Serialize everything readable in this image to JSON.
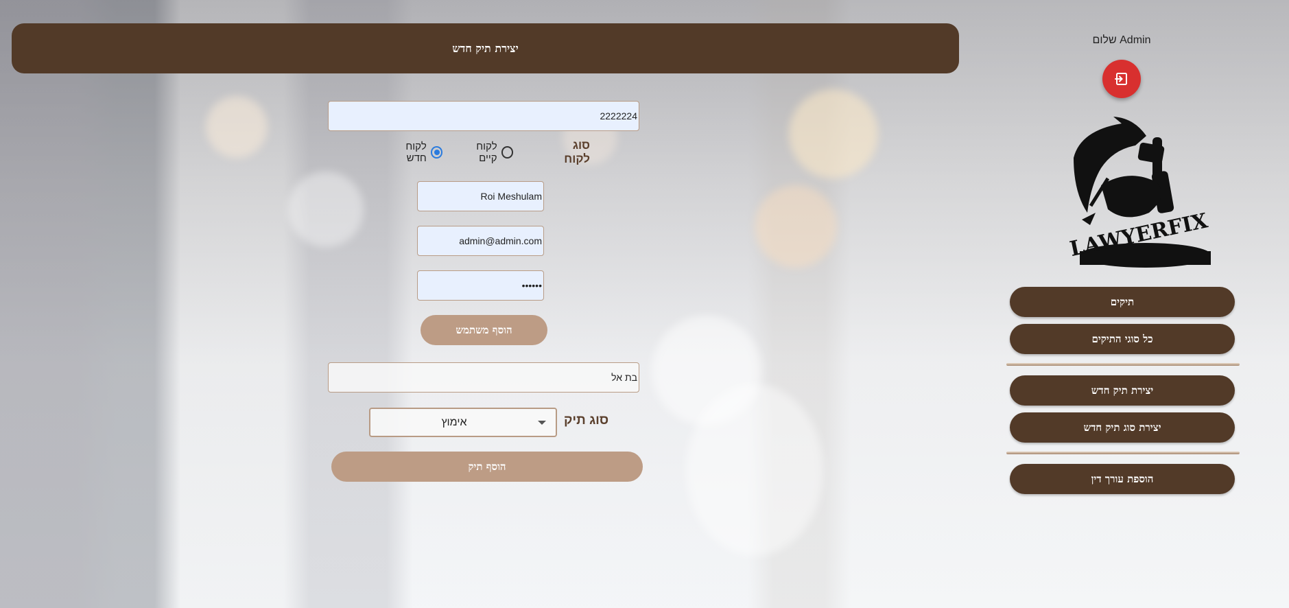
{
  "header": {
    "title": "יצירת תיק חדש"
  },
  "form": {
    "case_number": "2222224",
    "client_type_label": "סוג לקוח",
    "client_type_options": [
      "לקוח חדש",
      "לקוח קיים"
    ],
    "client_type_selected": "לקוח חדש",
    "client_name": "Roi Meshulam",
    "client_email": "admin@admin.com",
    "client_password": "••••••",
    "add_user_label": "הוסף משתמש",
    "lawyer_name": "בת אל",
    "case_type_label": "סוג תיק",
    "case_type_value": "אימוץ",
    "add_case_label": "הוסף תיק"
  },
  "sidebar": {
    "greeting": "שלום Admin",
    "logo_text": "LAWYERFIX",
    "nav": {
      "cases": "תיקים",
      "all_case_types": "כל סוגי התיקים",
      "create_case": "יצירת תיק חדש",
      "create_case_type": "יצירת סוג תיק חדש",
      "add_lawyer": "הוספת עורך דין"
    }
  },
  "colors": {
    "brown": "#523a28",
    "tan": "#bd9c85",
    "logout": "#d8302f",
    "radio_accent": "#2a7bde"
  },
  "icons": {
    "logout": "logout-icon"
  }
}
